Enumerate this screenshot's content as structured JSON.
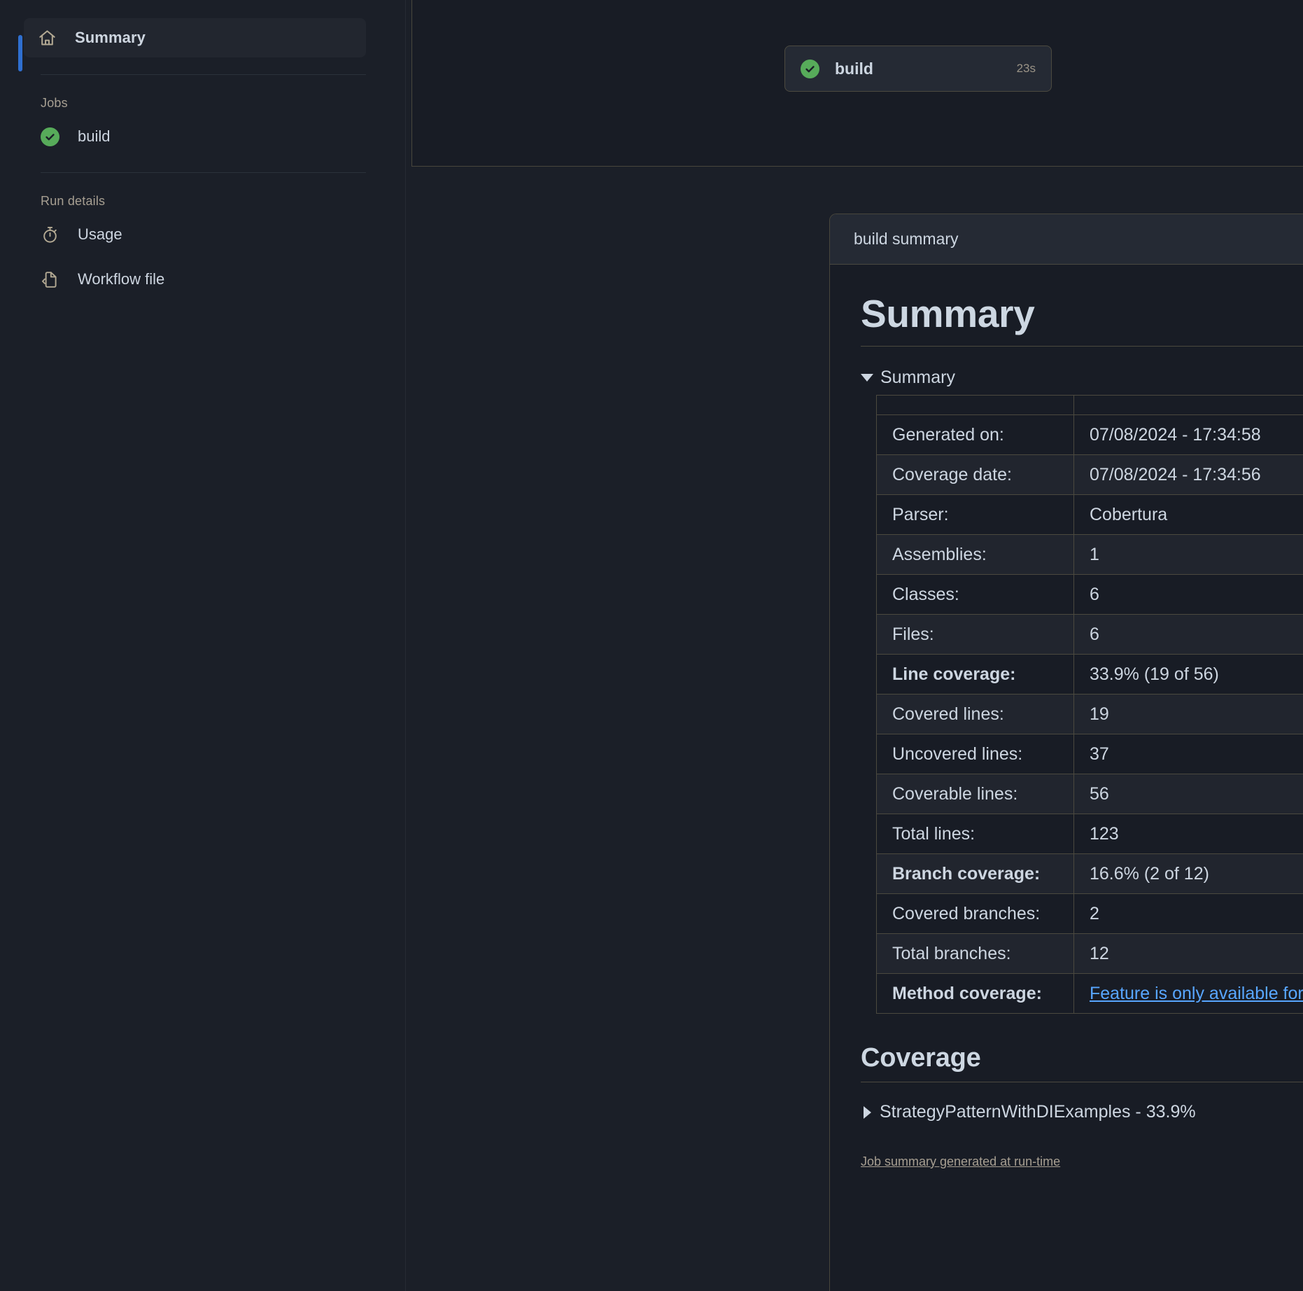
{
  "sidebar": {
    "summary_item": {
      "label": "Summary",
      "icon": "home-icon"
    },
    "jobs_section": {
      "title": "Jobs"
    },
    "jobs": [
      {
        "label": "build",
        "status": "success"
      }
    ],
    "run_details_section": {
      "title": "Run details"
    },
    "run_details": [
      {
        "label": "Usage",
        "icon": "stopwatch-icon"
      },
      {
        "label": "Workflow file",
        "icon": "file-code-icon"
      }
    ]
  },
  "graph": {
    "node": {
      "name": "build",
      "duration": "23s",
      "status": "success"
    },
    "controls": {
      "fullscreen": "fullscreen-icon",
      "zoom_out": "−",
      "zoom_in": "+"
    }
  },
  "summary_panel": {
    "header_title": "build summary",
    "menu": "kebab-menu",
    "h1": "Summary",
    "details_toggle": "Summary",
    "table": {
      "rows": [
        {
          "label": "Generated on:",
          "value": "07/08/2024 - 17:34:58",
          "bold": false
        },
        {
          "label": "Coverage date:",
          "value": "07/08/2024 - 17:34:56",
          "bold": false
        },
        {
          "label": "Parser:",
          "value": "Cobertura",
          "bold": false
        },
        {
          "label": "Assemblies:",
          "value": "1",
          "bold": false
        },
        {
          "label": "Classes:",
          "value": "6",
          "bold": false
        },
        {
          "label": "Files:",
          "value": "6",
          "bold": false
        },
        {
          "label": "Line coverage:",
          "value": "33.9% (19 of 56)",
          "bold": true
        },
        {
          "label": "Covered lines:",
          "value": "19",
          "bold": false
        },
        {
          "label": "Uncovered lines:",
          "value": "37",
          "bold": false
        },
        {
          "label": "Coverable lines:",
          "value": "56",
          "bold": false
        },
        {
          "label": "Total lines:",
          "value": "123",
          "bold": false
        },
        {
          "label": "Branch coverage:",
          "value": "16.6% (2 of 12)",
          "bold": true
        },
        {
          "label": "Covered branches:",
          "value": "2",
          "bold": false
        },
        {
          "label": "Total branches:",
          "value": "12",
          "bold": false
        },
        {
          "label": "Method coverage:",
          "value": "Feature is only available for sponsors",
          "bold": true,
          "link": true
        }
      ]
    },
    "coverage_heading": "Coverage",
    "coverage_items": [
      {
        "label": "StrategyPatternWithDIExamples - 33.9%"
      }
    ],
    "footnote": "Job summary generated at run-time"
  },
  "colors": {
    "page_bg": "#1b1f28",
    "panel_bg": "#181c25",
    "panel_header_bg": "#252a34",
    "border": "#48463c",
    "accent_blue": "#2f6fd0",
    "link_blue": "#58a6ff",
    "success_green": "#57ab5a",
    "muted_tan": "#a79f92",
    "text": "#cdd6e1"
  }
}
